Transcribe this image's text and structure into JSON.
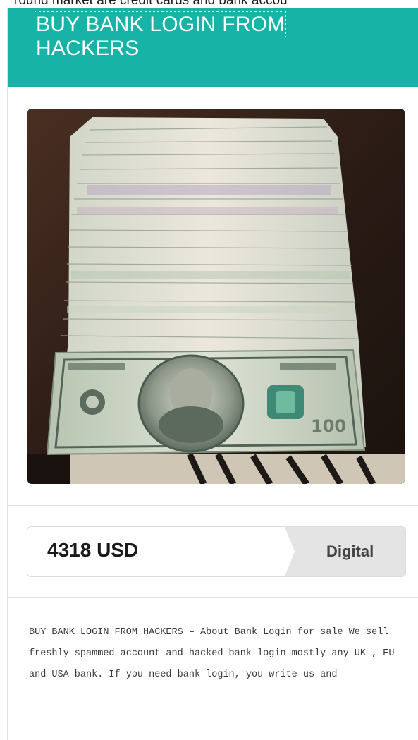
{
  "page": {
    "top_strip_text": "round market are credit cards and bank accou"
  },
  "product": {
    "title": "BUY BANK LOGIN FROM HACKERS",
    "price": "4318 USD",
    "type_label": "Digital",
    "description": "BUY BANK LOGIN FROM HACKERS – About Bank Login for sale We sell freshly spammed account and hacked bank login mostly any UK , EU and USA bank. If you need bank login, you write us and",
    "image": {
      "icon": "cash-stack-photo",
      "bill_value": "100"
    }
  },
  "colors": {
    "header": "#17b3a7",
    "badge": "#e4e4e4",
    "divider": "#e3e3e3"
  }
}
